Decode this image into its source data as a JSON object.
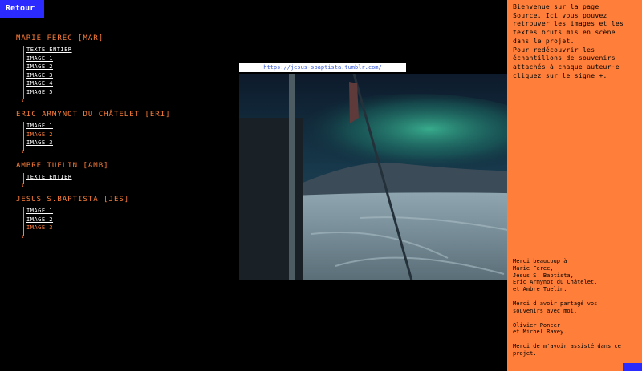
{
  "back_button": "Retour",
  "authors": [
    {
      "name": "Marie Ferec [MAR]",
      "items": [
        {
          "label": "Texte entier",
          "color": "white"
        },
        {
          "label": "Image 1",
          "color": "white"
        },
        {
          "label": "Image 2",
          "color": "white"
        },
        {
          "label": "Image 3",
          "color": "white"
        },
        {
          "label": "Image 4",
          "color": "white"
        },
        {
          "label": "Image 5",
          "color": "white"
        }
      ]
    },
    {
      "name": "Eric Armynot du Châtelet [ERI]",
      "items": [
        {
          "label": "Image 1",
          "color": "white"
        },
        {
          "label": "Image 2",
          "color": "orange"
        },
        {
          "label": "Image 3",
          "color": "white"
        }
      ]
    },
    {
      "name": "Ambre Tuelin [AMB]",
      "items": [
        {
          "label": "Texte entier",
          "color": "white"
        }
      ]
    },
    {
      "name": "Jesus S.Baptista [JES]",
      "items": [
        {
          "label": "Image 1",
          "color": "white"
        },
        {
          "label": "Image 2",
          "color": "white"
        },
        {
          "label": "Image 3",
          "color": "orange"
        }
      ]
    }
  ],
  "image_url": "https://jesus-sbaptista.tumblr.com/",
  "sidebar": {
    "intro_lines": [
      "Bienvenue sur la page",
      "Source. Ici vous pouvez",
      "retrouver les images et les",
      "textes bruts mis en scène",
      "dans le projet.",
      "Pour redécouvrir les",
      "échantillons de souvenirs",
      "attachés à chaque auteur·e",
      "cliquez sur le signe +."
    ],
    "thanks_paragraphs": [
      [
        "Merci beaucoup à",
        "Marie Ferec,",
        "Jesus S. Baptista,",
        "Eric Armynot du Châtelet,",
        "et Ambre Tuelin."
      ],
      [
        "Merci d'avoir partagé vos",
        "souvenirs avec moi."
      ],
      [
        "Olivier Poncer",
        "et Michel Ravey."
      ],
      [
        "Merci de m'avoir assisté dans ce",
        "projet."
      ]
    ]
  },
  "colors": {
    "accent": "#ff7f3a",
    "button": "#2b2bff",
    "background": "#000000"
  }
}
